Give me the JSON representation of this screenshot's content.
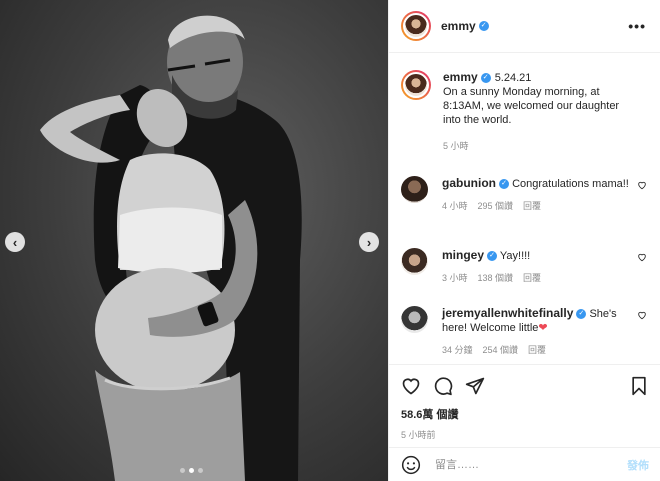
{
  "header": {
    "username": "emmy",
    "more_label": "•••"
  },
  "caption": {
    "username": "emmy",
    "date": "5.24.21",
    "text": "On a sunny Monday morning, at 8:13AM, we welcomed our daughter into the world.",
    "time": "5 小時"
  },
  "comments": [
    {
      "username": "gabunion",
      "text": "Congratulations mama!!",
      "time": "4 小時",
      "likes": "295 個讚",
      "reply": "回覆"
    },
    {
      "username": "mingey",
      "text": "Yay!!!!",
      "time": "3 小時",
      "likes": "138 個讚",
      "reply": "回覆"
    },
    {
      "username": "jeremyallenwhitefinally",
      "text": "She's here! Welcome little",
      "emoji": "❤",
      "time": "34 分鐘",
      "likes": "254 個讚",
      "reply": "回覆"
    }
  ],
  "actions": {
    "likes": "58.6萬 個讚",
    "posted": "5 小時前"
  },
  "composer": {
    "placeholder": "留言……",
    "post_label": "發佈"
  },
  "carousel": {
    "prev": "‹",
    "next": "›",
    "slide_count": 3,
    "active_slide": 2
  },
  "colors": {
    "verified": "#3897f0",
    "heart": "#ed4956",
    "post_disabled": "#b2dffc"
  }
}
